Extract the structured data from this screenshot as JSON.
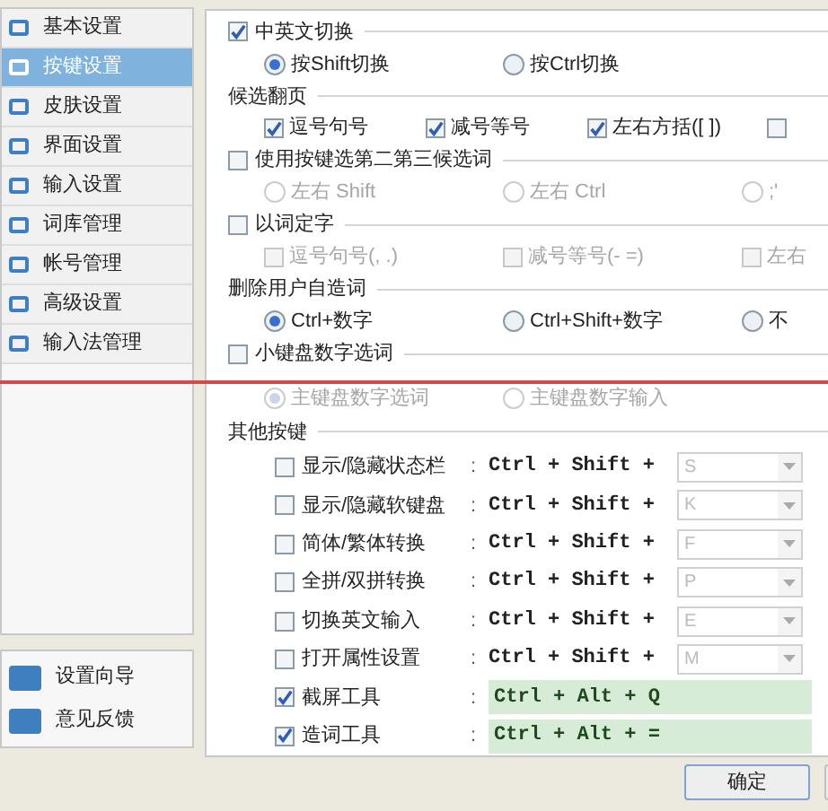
{
  "sidebar": {
    "items": [
      {
        "label": "基本设置",
        "selected": false
      },
      {
        "label": "按键设置",
        "selected": true
      },
      {
        "label": "皮肤设置",
        "selected": false
      },
      {
        "label": "界面设置",
        "selected": false
      },
      {
        "label": "输入设置",
        "selected": false
      },
      {
        "label": "词库管理",
        "selected": false
      },
      {
        "label": "帐号管理",
        "selected": false
      },
      {
        "label": "高级设置",
        "selected": false
      },
      {
        "label": "输入法管理",
        "selected": false
      }
    ],
    "footer_items": [
      "设置向导",
      "意见反馈"
    ]
  },
  "settings": [
    {
      "kind": "checkbox_header",
      "label": "中英文切换",
      "checked": true
    },
    {
      "kind": "radio_group",
      "options": [
        {
          "label": "按Shift切换",
          "selected": true,
          "disabled": false
        },
        {
          "label": "按Ctrl切换",
          "selected": false,
          "disabled": false
        }
      ]
    },
    {
      "kind": "header",
      "label": "候选翻页"
    },
    {
      "kind": "checkbox_group",
      "options": [
        {
          "label": "逗号句号",
          "checked": true,
          "disabled": false
        },
        {
          "label": "减号等号",
          "checked": true,
          "disabled": false
        },
        {
          "label": "左右方括([ ])",
          "checked": true,
          "disabled": false
        },
        {
          "checked": false,
          "disabled": false
        }
      ]
    },
    {
      "kind": "checkbox_header",
      "label": "使用按键选第二第三候选词",
      "checked": false
    },
    {
      "kind": "radio_group",
      "options": [
        {
          "label": "左右 Shift",
          "selected": false,
          "disabled": true
        },
        {
          "label": "左右 Ctrl",
          "selected": false,
          "disabled": true
        },
        {
          "label": ";'",
          "selected": false,
          "disabled": true
        }
      ]
    },
    {
      "kind": "checkbox_header",
      "label": "以词定字",
      "checked": false
    },
    {
      "kind": "checkbox_group",
      "options": [
        {
          "label": "逗号句号(, .)",
          "checked": false,
          "disabled": true
        },
        {
          "label": "减号等号(- =)",
          "checked": false,
          "disabled": true
        },
        {
          "label": "左右",
          "checked": false,
          "disabled": true
        }
      ]
    },
    {
      "kind": "header",
      "label": "删除用户自造词"
    },
    {
      "kind": "radio_group",
      "options": [
        {
          "label": "Ctrl+数字",
          "selected": true,
          "disabled": false
        },
        {
          "label": "Ctrl+Shift+数字",
          "selected": false,
          "disabled": false
        },
        {
          "label": "不",
          "selected": false,
          "disabled": false
        }
      ]
    },
    {
      "kind": "checkbox_header",
      "label": "小键盘数字选词",
      "checked": false
    },
    {
      "kind": "radio_group",
      "options": [
        {
          "label": "主键盘数字选词",
          "selected": true,
          "disabled": true
        },
        {
          "label": "主键盘数字输入",
          "selected": false,
          "disabled": true
        }
      ]
    }
  ],
  "hotkeys": {
    "title": "其他按键",
    "rows": [
      {
        "kind": "combo",
        "label": "显示/隐藏状态栏",
        "colon": ":",
        "checked": false,
        "modifier": "Ctrl + Shift +",
        "key": "S"
      },
      {
        "kind": "combo",
        "label": "显示/隐藏软键盘",
        "colon": ":",
        "checked": false,
        "modifier": "Ctrl + Shift +",
        "key": "K"
      },
      {
        "kind": "combo",
        "label": "简体/繁体转换",
        "colon": ":",
        "checked": false,
        "modifier": "Ctrl + Shift +",
        "key": "F"
      },
      {
        "kind": "combo",
        "label": "全拼/双拼转换",
        "colon": ":",
        "checked": false,
        "modifier": "Ctrl + Shift +",
        "key": "P"
      },
      {
        "kind": "combo",
        "label": "切换英文输入",
        "colon": ":",
        "checked": false,
        "modifier": "Ctrl + Shift +",
        "key": "E"
      },
      {
        "kind": "combo",
        "label": "打开属性设置",
        "colon": ":",
        "checked": false,
        "modifier": "Ctrl + Shift +",
        "key": "M"
      },
      {
        "kind": "field",
        "label": "截屏工具",
        "colon": ":",
        "checked": true,
        "value": "Ctrl + Alt + Q"
      },
      {
        "kind": "field",
        "label": "造词工具",
        "colon": ":",
        "checked": true,
        "value": "Ctrl + Alt + ="
      }
    ]
  },
  "buttons": [
    "确定"
  ]
}
